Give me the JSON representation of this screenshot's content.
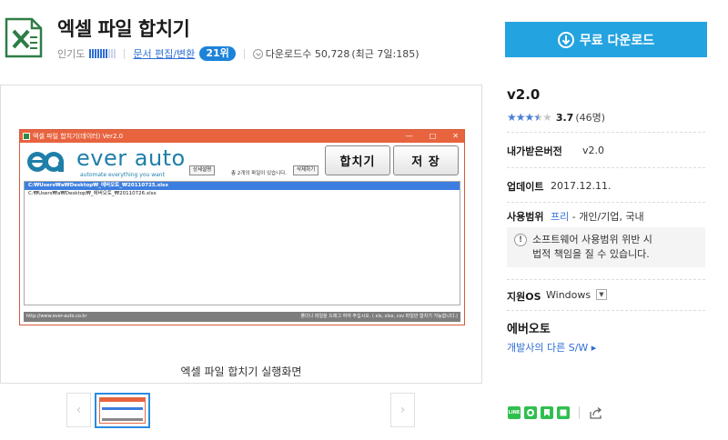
{
  "app": {
    "title": "엑셀 파일 합치기",
    "popularity_label": "인기도",
    "popularity_level": 0.7,
    "category": "문서 편집/변환",
    "rank": "21위",
    "download_count": "다운로드수 50,728",
    "download_recent": "(최근 7일:185)"
  },
  "download_button": {
    "label": "무료 다운로드",
    "color": "#23a3e0"
  },
  "screenshot": {
    "caption": "엑셀 파일 합치기 실행화면",
    "window_title": "엑셀 파일 합치기(데이터) Ver2.0",
    "window_controls": [
      "—",
      "□",
      "✕"
    ],
    "brand_name": "ever auto",
    "brand_tagline": "automate everything you want",
    "help_button": "상세설명",
    "file_count_note": "총 2개의 파일이 있습니다.",
    "delete_button": "삭제하기",
    "merge_button": "합치기",
    "save_button": "저 장",
    "files": [
      "C:₩Users₩a₩Desktop₩_에버오토_₩20110725.xlsx",
      "C:₩Users₩a₩Desktop₩_에버오토_₩20110726.xlsx"
    ],
    "status_left": "http://www.ever-auto.co.kr",
    "status_right": "폴더나 파일을 드래그 하여 주십시오. ( xls, xlsx, csv 파일만 합치기 가능합니다.)",
    "prev_icon": "chevron-left-icon",
    "next_icon": "chevron-right-icon"
  },
  "info": {
    "version": "v2.0",
    "rating": "3.7",
    "rating_count": "(46명)",
    "rating_value": 3.7,
    "my_version_label": "내가받은버전",
    "my_version": "v2.0",
    "update_label": "업데이트",
    "update_date": "2017.12.11.",
    "scope_label": "사용범위",
    "scope_free": "프리",
    "scope_value": "- 개인/기업, 국내",
    "warning_line1": "소프트웨어 사용범위 위반 시",
    "warning_line2": "법적 책임을 질 수 있습니다.",
    "os_label": "지원OS",
    "os_value": "Windows",
    "developer": "에버오토",
    "developer_link": "개발사의 다른 S/W ▸"
  },
  "share": {
    "icons": [
      "line-icon",
      "band-icon",
      "bookmark-icon",
      "kakao-icon"
    ],
    "share_icon": "share-icon"
  },
  "colors": {
    "accent": "#23a3e0",
    "link": "#2f6fd6",
    "window_title": "#e8643f",
    "selection": "#3c7ee0",
    "brand": "#1e7fa8"
  }
}
